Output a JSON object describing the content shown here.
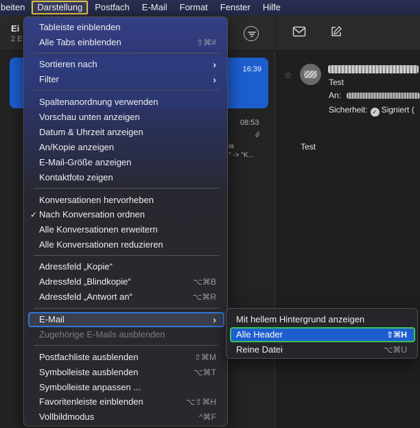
{
  "menubar": {
    "items": [
      "beiten",
      "Darstellung",
      "Postfach",
      "E-Mail",
      "Format",
      "Fenster",
      "Hilfe"
    ]
  },
  "list_pane": {
    "mailbox_title": "Ei",
    "mailbox_count": "2 E",
    "selected_time": "16:39",
    "msg2_time": "08:53",
    "msg2_snippet_1": "ia",
    "msg2_snippet_2": "\" -> \"K..."
  },
  "message": {
    "subject": "Test",
    "to_label": "An:",
    "security_label": "Sicherheit:",
    "security_value": "Signiert (",
    "body": "Test"
  },
  "view_menu": {
    "items": [
      {
        "label": "Tableiste einblenden",
        "shortcut": ""
      },
      {
        "label": "Alle Tabs einblenden",
        "shortcut": "⇧⌘#"
      },
      {
        "label": "Sortieren nach",
        "submenu": true
      },
      {
        "label": "Filter",
        "submenu": true
      },
      {
        "label": "Spaltenanordnung verwenden",
        "shortcut": ""
      },
      {
        "label": "Vorschau unten anzeigen",
        "shortcut": ""
      },
      {
        "label": "Datum & Uhrzeit anzeigen",
        "shortcut": ""
      },
      {
        "label": "An/Kopie anzeigen",
        "shortcut": ""
      },
      {
        "label": "E-Mail-Größe anzeigen",
        "shortcut": ""
      },
      {
        "label": "Kontaktfoto zeigen",
        "shortcut": ""
      },
      {
        "label": "Konversationen hervorheben",
        "shortcut": ""
      },
      {
        "label": "Nach Konversation ordnen",
        "checked": true
      },
      {
        "label": "Alle Konversationen erweitern",
        "shortcut": ""
      },
      {
        "label": "Alle Konversationen reduzieren",
        "shortcut": ""
      },
      {
        "label": "Adressfeld „Kopie“",
        "shortcut": ""
      },
      {
        "label": "Adressfeld „Blindkopie“",
        "shortcut": "⌥⌘B"
      },
      {
        "label": "Adressfeld „Antwort an“",
        "shortcut": "⌥⌘R"
      },
      {
        "label": "E-Mail",
        "submenu": true,
        "active": true
      },
      {
        "label": "Zugehörige E-Mails ausblenden",
        "disabled": true
      },
      {
        "label": "Postfachliste ausblenden",
        "shortcut": "⇧⌘M"
      },
      {
        "label": "Symbolleiste ausblenden",
        "shortcut": "⌥⌘T"
      },
      {
        "label": "Symbolleiste anpassen ...",
        "shortcut": ""
      },
      {
        "label": "Favoritenleiste einblenden",
        "shortcut": "⌥⇧⌘H"
      },
      {
        "label": "Vollbildmodus",
        "shortcut": "^⌘F"
      }
    ],
    "checkmark": "✓",
    "submenu_arrow": "›"
  },
  "email_submenu": {
    "items": [
      {
        "label": "Mit hellem Hintergrund anzeigen",
        "shortcut": ""
      },
      {
        "label": "Alle Header",
        "shortcut": "⇧⌘H",
        "selected": true
      },
      {
        "label": "Reine Datei",
        "shortcut": "⌥⌘U"
      }
    ]
  },
  "colors": {
    "menubar_highlight_outline": "#e2c24a",
    "active_item_outline": "#2f78d8",
    "selected_submenu_item_bg": "#1d5ecf",
    "selected_submenu_item_outline": "#36c45a"
  }
}
